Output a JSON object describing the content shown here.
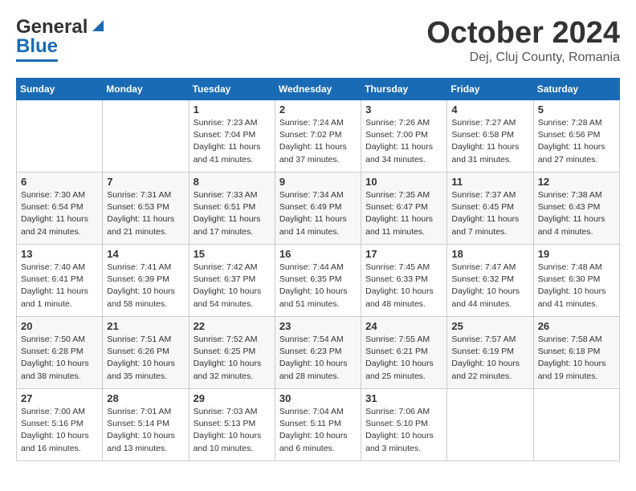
{
  "header": {
    "logo_line1": "General",
    "logo_line2": "Blue",
    "month": "October 2024",
    "location": "Dej, Cluj County, Romania"
  },
  "weekdays": [
    "Sunday",
    "Monday",
    "Tuesday",
    "Wednesday",
    "Thursday",
    "Friday",
    "Saturday"
  ],
  "weeks": [
    [
      null,
      null,
      {
        "day": 1,
        "sunrise": "7:23 AM",
        "sunset": "7:04 PM",
        "daylight": "11 hours and 41 minutes."
      },
      {
        "day": 2,
        "sunrise": "7:24 AM",
        "sunset": "7:02 PM",
        "daylight": "11 hours and 37 minutes."
      },
      {
        "day": 3,
        "sunrise": "7:26 AM",
        "sunset": "7:00 PM",
        "daylight": "11 hours and 34 minutes."
      },
      {
        "day": 4,
        "sunrise": "7:27 AM",
        "sunset": "6:58 PM",
        "daylight": "11 hours and 31 minutes."
      },
      {
        "day": 5,
        "sunrise": "7:28 AM",
        "sunset": "6:56 PM",
        "daylight": "11 hours and 27 minutes."
      }
    ],
    [
      {
        "day": 6,
        "sunrise": "7:30 AM",
        "sunset": "6:54 PM",
        "daylight": "11 hours and 24 minutes."
      },
      {
        "day": 7,
        "sunrise": "7:31 AM",
        "sunset": "6:53 PM",
        "daylight": "11 hours and 21 minutes."
      },
      {
        "day": 8,
        "sunrise": "7:33 AM",
        "sunset": "6:51 PM",
        "daylight": "11 hours and 17 minutes."
      },
      {
        "day": 9,
        "sunrise": "7:34 AM",
        "sunset": "6:49 PM",
        "daylight": "11 hours and 14 minutes."
      },
      {
        "day": 10,
        "sunrise": "7:35 AM",
        "sunset": "6:47 PM",
        "daylight": "11 hours and 11 minutes."
      },
      {
        "day": 11,
        "sunrise": "7:37 AM",
        "sunset": "6:45 PM",
        "daylight": "11 hours and 7 minutes."
      },
      {
        "day": 12,
        "sunrise": "7:38 AM",
        "sunset": "6:43 PM",
        "daylight": "11 hours and 4 minutes."
      }
    ],
    [
      {
        "day": 13,
        "sunrise": "7:40 AM",
        "sunset": "6:41 PM",
        "daylight": "11 hours and 1 minute."
      },
      {
        "day": 14,
        "sunrise": "7:41 AM",
        "sunset": "6:39 PM",
        "daylight": "10 hours and 58 minutes."
      },
      {
        "day": 15,
        "sunrise": "7:42 AM",
        "sunset": "6:37 PM",
        "daylight": "10 hours and 54 minutes."
      },
      {
        "day": 16,
        "sunrise": "7:44 AM",
        "sunset": "6:35 PM",
        "daylight": "10 hours and 51 minutes."
      },
      {
        "day": 17,
        "sunrise": "7:45 AM",
        "sunset": "6:33 PM",
        "daylight": "10 hours and 48 minutes."
      },
      {
        "day": 18,
        "sunrise": "7:47 AM",
        "sunset": "6:32 PM",
        "daylight": "10 hours and 44 minutes."
      },
      {
        "day": 19,
        "sunrise": "7:48 AM",
        "sunset": "6:30 PM",
        "daylight": "10 hours and 41 minutes."
      }
    ],
    [
      {
        "day": 20,
        "sunrise": "7:50 AM",
        "sunset": "6:28 PM",
        "daylight": "10 hours and 38 minutes."
      },
      {
        "day": 21,
        "sunrise": "7:51 AM",
        "sunset": "6:26 PM",
        "daylight": "10 hours and 35 minutes."
      },
      {
        "day": 22,
        "sunrise": "7:52 AM",
        "sunset": "6:25 PM",
        "daylight": "10 hours and 32 minutes."
      },
      {
        "day": 23,
        "sunrise": "7:54 AM",
        "sunset": "6:23 PM",
        "daylight": "10 hours and 28 minutes."
      },
      {
        "day": 24,
        "sunrise": "7:55 AM",
        "sunset": "6:21 PM",
        "daylight": "10 hours and 25 minutes."
      },
      {
        "day": 25,
        "sunrise": "7:57 AM",
        "sunset": "6:19 PM",
        "daylight": "10 hours and 22 minutes."
      },
      {
        "day": 26,
        "sunrise": "7:58 AM",
        "sunset": "6:18 PM",
        "daylight": "10 hours and 19 minutes."
      }
    ],
    [
      {
        "day": 27,
        "sunrise": "7:00 AM",
        "sunset": "5:16 PM",
        "daylight": "10 hours and 16 minutes."
      },
      {
        "day": 28,
        "sunrise": "7:01 AM",
        "sunset": "5:14 PM",
        "daylight": "10 hours and 13 minutes."
      },
      {
        "day": 29,
        "sunrise": "7:03 AM",
        "sunset": "5:13 PM",
        "daylight": "10 hours and 10 minutes."
      },
      {
        "day": 30,
        "sunrise": "7:04 AM",
        "sunset": "5:11 PM",
        "daylight": "10 hours and 6 minutes."
      },
      {
        "day": 31,
        "sunrise": "7:06 AM",
        "sunset": "5:10 PM",
        "daylight": "10 hours and 3 minutes."
      },
      null,
      null
    ]
  ]
}
